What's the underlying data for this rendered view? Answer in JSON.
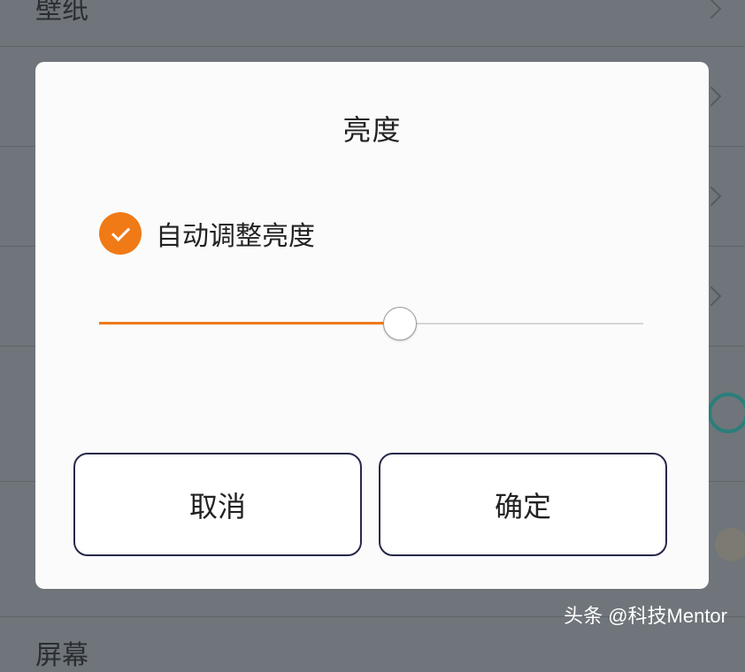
{
  "background_list": {
    "top_item_label": "壁纸",
    "bottom_item_label": "屏幕"
  },
  "dialog": {
    "title": "亮度",
    "auto_brightness": {
      "label": "自动调整亮度",
      "checked": true
    },
    "brightness_slider": {
      "value_fraction": 0.553
    },
    "cancel_label": "取消",
    "confirm_label": "确定"
  },
  "watermark": "头条 @科技Mentor",
  "colors": {
    "accent": "#f07a16",
    "overlay": "#6f757a",
    "dialog_bg": "#fbfbfb",
    "button_border": "#26284a"
  }
}
